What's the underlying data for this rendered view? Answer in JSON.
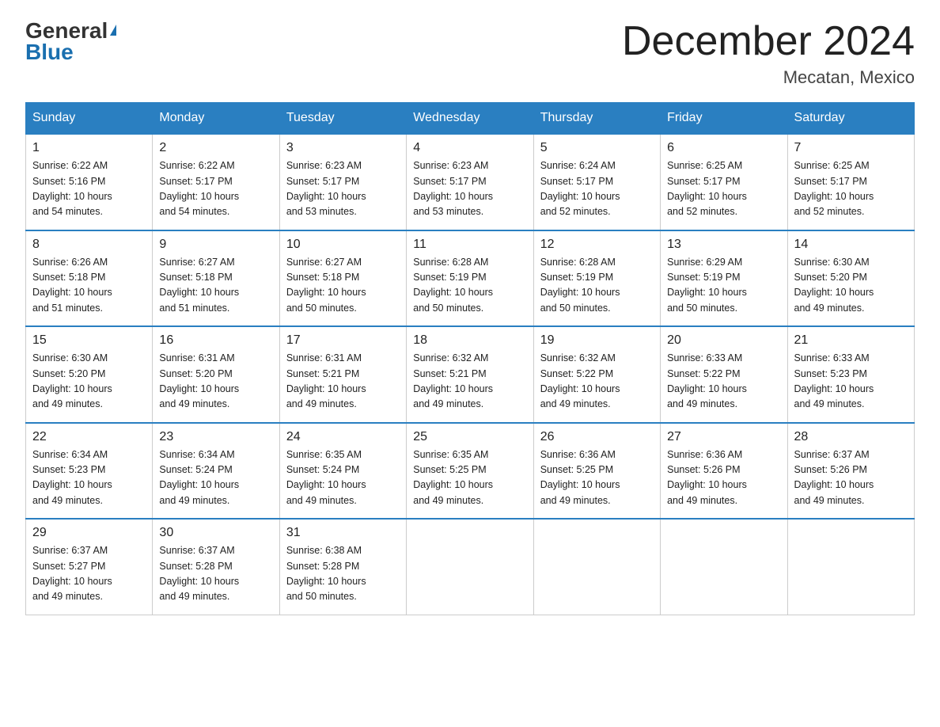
{
  "header": {
    "logo_general": "General",
    "logo_blue": "Blue",
    "month_title": "December 2024",
    "location": "Mecatan, Mexico"
  },
  "days_of_week": [
    "Sunday",
    "Monday",
    "Tuesday",
    "Wednesday",
    "Thursday",
    "Friday",
    "Saturday"
  ],
  "weeks": [
    [
      {
        "day": "1",
        "sunrise": "6:22 AM",
        "sunset": "5:16 PM",
        "daylight": "10 hours and 54 minutes."
      },
      {
        "day": "2",
        "sunrise": "6:22 AM",
        "sunset": "5:17 PM",
        "daylight": "10 hours and 54 minutes."
      },
      {
        "day": "3",
        "sunrise": "6:23 AM",
        "sunset": "5:17 PM",
        "daylight": "10 hours and 53 minutes."
      },
      {
        "day": "4",
        "sunrise": "6:23 AM",
        "sunset": "5:17 PM",
        "daylight": "10 hours and 53 minutes."
      },
      {
        "day": "5",
        "sunrise": "6:24 AM",
        "sunset": "5:17 PM",
        "daylight": "10 hours and 52 minutes."
      },
      {
        "day": "6",
        "sunrise": "6:25 AM",
        "sunset": "5:17 PM",
        "daylight": "10 hours and 52 minutes."
      },
      {
        "day": "7",
        "sunrise": "6:25 AM",
        "sunset": "5:17 PM",
        "daylight": "10 hours and 52 minutes."
      }
    ],
    [
      {
        "day": "8",
        "sunrise": "6:26 AM",
        "sunset": "5:18 PM",
        "daylight": "10 hours and 51 minutes."
      },
      {
        "day": "9",
        "sunrise": "6:27 AM",
        "sunset": "5:18 PM",
        "daylight": "10 hours and 51 minutes."
      },
      {
        "day": "10",
        "sunrise": "6:27 AM",
        "sunset": "5:18 PM",
        "daylight": "10 hours and 50 minutes."
      },
      {
        "day": "11",
        "sunrise": "6:28 AM",
        "sunset": "5:19 PM",
        "daylight": "10 hours and 50 minutes."
      },
      {
        "day": "12",
        "sunrise": "6:28 AM",
        "sunset": "5:19 PM",
        "daylight": "10 hours and 50 minutes."
      },
      {
        "day": "13",
        "sunrise": "6:29 AM",
        "sunset": "5:19 PM",
        "daylight": "10 hours and 50 minutes."
      },
      {
        "day": "14",
        "sunrise": "6:30 AM",
        "sunset": "5:20 PM",
        "daylight": "10 hours and 49 minutes."
      }
    ],
    [
      {
        "day": "15",
        "sunrise": "6:30 AM",
        "sunset": "5:20 PM",
        "daylight": "10 hours and 49 minutes."
      },
      {
        "day": "16",
        "sunrise": "6:31 AM",
        "sunset": "5:20 PM",
        "daylight": "10 hours and 49 minutes."
      },
      {
        "day": "17",
        "sunrise": "6:31 AM",
        "sunset": "5:21 PM",
        "daylight": "10 hours and 49 minutes."
      },
      {
        "day": "18",
        "sunrise": "6:32 AM",
        "sunset": "5:21 PM",
        "daylight": "10 hours and 49 minutes."
      },
      {
        "day": "19",
        "sunrise": "6:32 AM",
        "sunset": "5:22 PM",
        "daylight": "10 hours and 49 minutes."
      },
      {
        "day": "20",
        "sunrise": "6:33 AM",
        "sunset": "5:22 PM",
        "daylight": "10 hours and 49 minutes."
      },
      {
        "day": "21",
        "sunrise": "6:33 AM",
        "sunset": "5:23 PM",
        "daylight": "10 hours and 49 minutes."
      }
    ],
    [
      {
        "day": "22",
        "sunrise": "6:34 AM",
        "sunset": "5:23 PM",
        "daylight": "10 hours and 49 minutes."
      },
      {
        "day": "23",
        "sunrise": "6:34 AM",
        "sunset": "5:24 PM",
        "daylight": "10 hours and 49 minutes."
      },
      {
        "day": "24",
        "sunrise": "6:35 AM",
        "sunset": "5:24 PM",
        "daylight": "10 hours and 49 minutes."
      },
      {
        "day": "25",
        "sunrise": "6:35 AM",
        "sunset": "5:25 PM",
        "daylight": "10 hours and 49 minutes."
      },
      {
        "day": "26",
        "sunrise": "6:36 AM",
        "sunset": "5:25 PM",
        "daylight": "10 hours and 49 minutes."
      },
      {
        "day": "27",
        "sunrise": "6:36 AM",
        "sunset": "5:26 PM",
        "daylight": "10 hours and 49 minutes."
      },
      {
        "day": "28",
        "sunrise": "6:37 AM",
        "sunset": "5:26 PM",
        "daylight": "10 hours and 49 minutes."
      }
    ],
    [
      {
        "day": "29",
        "sunrise": "6:37 AM",
        "sunset": "5:27 PM",
        "daylight": "10 hours and 49 minutes."
      },
      {
        "day": "30",
        "sunrise": "6:37 AM",
        "sunset": "5:28 PM",
        "daylight": "10 hours and 49 minutes."
      },
      {
        "day": "31",
        "sunrise": "6:38 AM",
        "sunset": "5:28 PM",
        "daylight": "10 hours and 50 minutes."
      },
      null,
      null,
      null,
      null
    ]
  ],
  "labels": {
    "sunrise": "Sunrise:",
    "sunset": "Sunset:",
    "daylight": "Daylight:"
  }
}
